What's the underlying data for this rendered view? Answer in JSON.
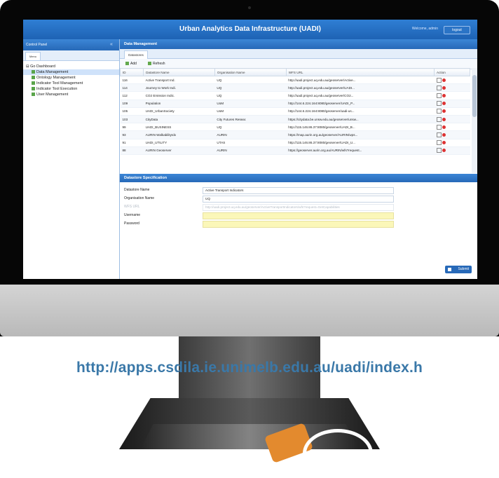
{
  "app": {
    "title": "Urban Analytics Data Infrastructure (UADI)",
    "welcome": "Welcome, admin",
    "logout_label": "logout"
  },
  "sidebar": {
    "header": "Control Panel",
    "tab": "Menu",
    "items": [
      {
        "label": "Go Dashboard"
      },
      {
        "label": "Data Management"
      },
      {
        "label": "Ontology Management"
      },
      {
        "label": "Indicator Tool Management"
      },
      {
        "label": "Indicator Tool Execution"
      },
      {
        "label": "User Management"
      }
    ]
  },
  "main": {
    "panel_title": "Data Management",
    "tab": "Datastores",
    "toolbar": {
      "add_label": "Add",
      "refresh_label": "Refresh"
    },
    "grid": {
      "columns": [
        "ID",
        "Datastore Name",
        "Organisation Name",
        "WFS URL",
        "Action"
      ],
      "rows": [
        [
          "116",
          "Active Transport Ind.",
          "UQ",
          "http://uadi.project.uq.edu.au/geoserver/Active..."
        ],
        [
          "114",
          "Journey to Work Indi.",
          "UQ",
          "http://uadi.project.uq.edu.au/geoserver/UADI..."
        ],
        [
          "112",
          "CO2 Emission Indic.",
          "UQ",
          "http://uadi.project.uq.edu.au/geoserver/CO2..."
        ],
        [
          "109",
          "Population",
          "UoM",
          "http://144.6.224.164:8080/geoserver/UADI_P..."
        ],
        [
          "105",
          "UADI_UrbanSociety",
          "UoM",
          "http://144.6.224.164:8080/geoserver/uadi-us..."
        ],
        [
          "103",
          "CityData",
          "City Futures Resear.",
          "https://citydata.be.unsw.edu.au/geoserver/unsw..."
        ],
        [
          "99",
          "UADI_BUSINESS",
          "UQ",
          "http://115.146.86.37:8080/geoserver/UADI_B..."
        ],
        [
          "93",
          "AURIN WalkabilityIdx",
          "AURIN",
          "https://map.aurin.org.au/geoserver/AURIN/wps..."
        ],
        [
          "91",
          "UADI_UTILITY",
          "UTAS",
          "http://115.146.86.37:8080/geoserver/UADI_U..."
        ],
        [
          "88",
          "AURIN Geoserver",
          "AURIN",
          "https://geoserver.aurin.org.au/AURIN/wfs?request..."
        ]
      ]
    },
    "spec": {
      "title": "Datastore Specification",
      "fields": [
        {
          "label": "Datastore Name",
          "value": "Active Transport Indicators"
        },
        {
          "label": "Organisation Name",
          "value": "UQ"
        },
        {
          "label": "WFS URL",
          "value": "http://uadi.project.uq.edu.au/geoserver/ActiveTransportIndicators/wfs?request=GetCapabilities"
        },
        {
          "label": "Username",
          "value": ""
        },
        {
          "label": "Password",
          "value": ""
        }
      ],
      "submit_label": "Submit"
    }
  },
  "footer_url": "http://apps.csdila.ie.unimelb.edu.au/uadi/index.h",
  "colors": {
    "brand_blue": "#2769b8",
    "accent_orange": "#e38a2e",
    "url_blue": "#3a78a8"
  }
}
